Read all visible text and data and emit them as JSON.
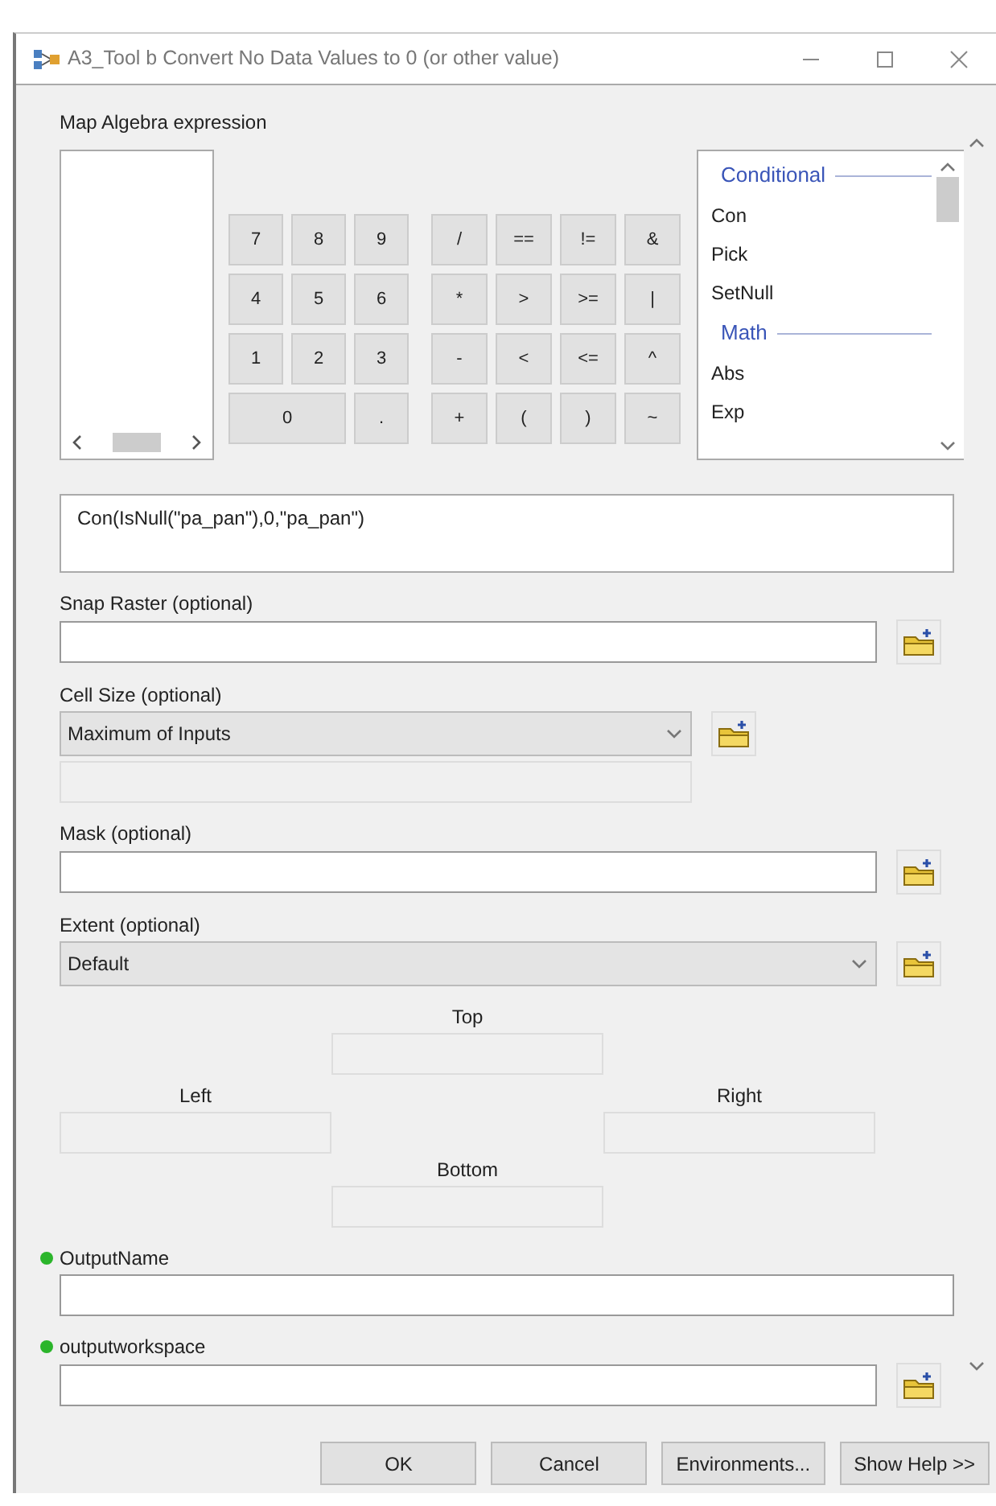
{
  "window": {
    "title": "A3_Tool b Convert No Data Values to 0 (or other value)"
  },
  "expression_label": "Map Algebra expression",
  "number_keys": [
    [
      "7",
      "8",
      "9"
    ],
    [
      "4",
      "5",
      "6"
    ],
    [
      "1",
      "2",
      "3"
    ],
    [
      "0",
      "."
    ]
  ],
  "operator_keys": [
    [
      "/",
      "==",
      "!=",
      "&"
    ],
    [
      "*",
      ">",
      ">=",
      "|"
    ],
    [
      "-",
      "<",
      "<=",
      "^"
    ],
    [
      "+",
      "(",
      ")",
      "~"
    ]
  ],
  "function_list": [
    {
      "kind": "heading",
      "text": "Conditional"
    },
    {
      "kind": "item",
      "text": "Con"
    },
    {
      "kind": "item",
      "text": "Pick"
    },
    {
      "kind": "item",
      "text": "SetNull"
    },
    {
      "kind": "heading",
      "text": "Math"
    },
    {
      "kind": "item",
      "text": "Abs"
    },
    {
      "kind": "item",
      "text": "Exp"
    }
  ],
  "expression": "Con(IsNull(\"pa_pan\"),0,\"pa_pan\")",
  "parameters": [
    {
      "kind": "file",
      "label": "Snap Raster (optional)",
      "required": false
    },
    {
      "kind": "choice",
      "label": "Cell Size (optional)",
      "value": "Maximum of Inputs",
      "required": false
    },
    {
      "kind": "file",
      "label": "Mask (optional)",
      "required": false
    },
    {
      "kind": "extent",
      "label": "Extent (optional)",
      "value": "Default",
      "required": false,
      "top": "Top",
      "left": "Left",
      "right": "Right",
      "bottom": "Bottom"
    },
    {
      "kind": "text",
      "label": "OutputName",
      "required": true
    },
    {
      "kind": "file",
      "label": "outputworkspace",
      "required": true
    }
  ],
  "buttons": [
    "OK",
    "Cancel",
    "Environments...",
    "Show Help >>"
  ]
}
